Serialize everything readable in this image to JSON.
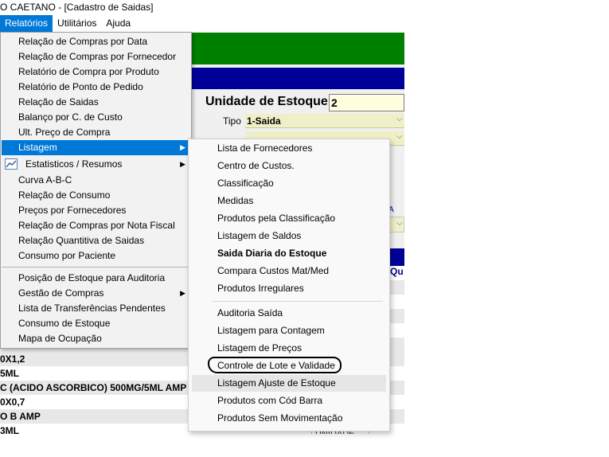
{
  "window": {
    "title": "O CAETANO - [Cadastro de Saidas]"
  },
  "menubar": {
    "items": [
      {
        "label": "Relatórios",
        "active": true
      },
      {
        "label": "Utilitários"
      },
      {
        "label": "Ajuda"
      }
    ]
  },
  "form": {
    "unit_label": "Unidade de Estoque",
    "unit_value": "2",
    "tipo_label": "Tipo",
    "tipo_value": "1-Saida",
    "dropdown_arrow": "⌵",
    "small_mark": "A",
    "grid_header_partial": "Qu"
  },
  "grid": {
    "rows": [
      {
        "text": "0X1,2",
        "alt": true
      },
      {
        "text": "5ML",
        "alt": false
      },
      {
        "text": "C (ACIDO ASCORBICO) 500MG/5ML AMP",
        "alt": true
      },
      {
        "text": "0X0,7",
        "alt": false
      },
      {
        "text": "O B AMP",
        "alt": true
      },
      {
        "text": "3ML",
        "alt": false
      }
    ],
    "unit_cell": "UNIDADE"
  },
  "relatorios_menu": {
    "items": [
      {
        "label": "Relação de Compras por Data"
      },
      {
        "label": "Relação de Compras por Fornecedor"
      },
      {
        "label": "Relatório de Compra por Produto"
      },
      {
        "label": "Relatório de Ponto de Pedido"
      },
      {
        "label": "Relação de Saidas"
      },
      {
        "label": "Balanço por C. de Custo"
      },
      {
        "label": "Ult. Preço de Compra"
      },
      {
        "label": "Listagem",
        "submenu": true,
        "highlighted": true
      },
      {
        "label": "Estatisticos / Resumos",
        "submenu": true,
        "icon": "chart-icon"
      },
      {
        "label": "Curva A-B-C"
      },
      {
        "label": "Relação de Consumo"
      },
      {
        "label": "Preços por Fornecedores"
      },
      {
        "label": "Relação de Compras por Nota Fiscal"
      },
      {
        "label": "Relação Quantitiva de Saidas"
      },
      {
        "label": "Consumo por Paciente"
      },
      {
        "label": "Posição de Estoque para Auditoria"
      },
      {
        "label": "Gestão de Compras",
        "submenu": true
      },
      {
        "label": "Lista de Transferências Pendentes"
      },
      {
        "label": "Consumo de Estoque"
      },
      {
        "label": "Mapa de Ocupação"
      }
    ],
    "submenu_arrow": "▶"
  },
  "listagem_menu": {
    "items": [
      {
        "label": "Lista de Fornecedores"
      },
      {
        "label": "Centro de Custos."
      },
      {
        "label": "Classificação"
      },
      {
        "label": "Medidas"
      },
      {
        "label": "Produtos pela Classificação"
      },
      {
        "label": "Listagem de Saldos"
      },
      {
        "label": "Saida Diaria do Estoque",
        "bold": true
      },
      {
        "label": "Compara Custos Mat/Med"
      },
      {
        "label": "Produtos Irregulares"
      },
      {
        "label": "Auditoria Saída"
      },
      {
        "label": "Listagem para Contagem"
      },
      {
        "label": "Listagem de Preços"
      },
      {
        "label": "Controle de Lote e Validade",
        "circled": true
      },
      {
        "label": "Listagem Ajuste de Estoque",
        "hover": true
      },
      {
        "label": "Produtos com Cód Barra"
      },
      {
        "label": "Produtos Sem Movimentação"
      }
    ]
  },
  "colors": {
    "menu_highlight": "#0078d7",
    "green_banner": "#008000",
    "blue_banner": "#000099",
    "field_yellow": "#efefc8"
  }
}
